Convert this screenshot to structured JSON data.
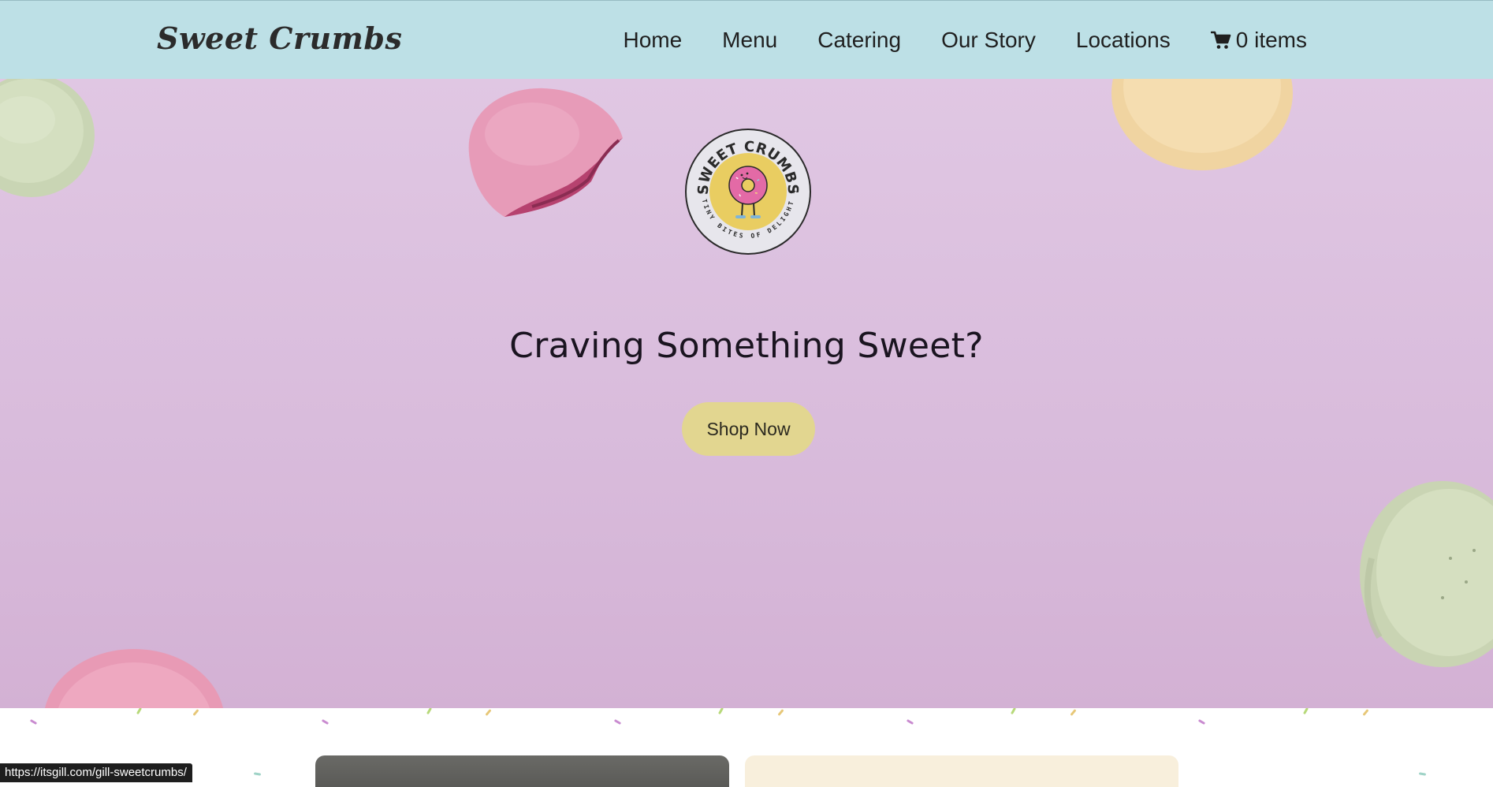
{
  "header": {
    "brand": "Sweet Crumbs",
    "nav": {
      "home": "Home",
      "menu": "Menu",
      "catering": "Catering",
      "our_story": "Our Story",
      "locations": "Locations",
      "cart_label": "0 items"
    },
    "cart_icon": "shopping-cart-icon",
    "background_color": "#bde0e6"
  },
  "hero": {
    "logo": {
      "top_text": "SWEET CRUMBS",
      "bottom_text": "TINY BITES OF DELIGHT"
    },
    "title": "Craving Something Sweet?",
    "button_label": "Shop Now",
    "button_color": "#e2d690",
    "background_color": "#dcc1df"
  },
  "status_bar": {
    "url": "https://itsgill.com/gill-sweetcrumbs/"
  }
}
